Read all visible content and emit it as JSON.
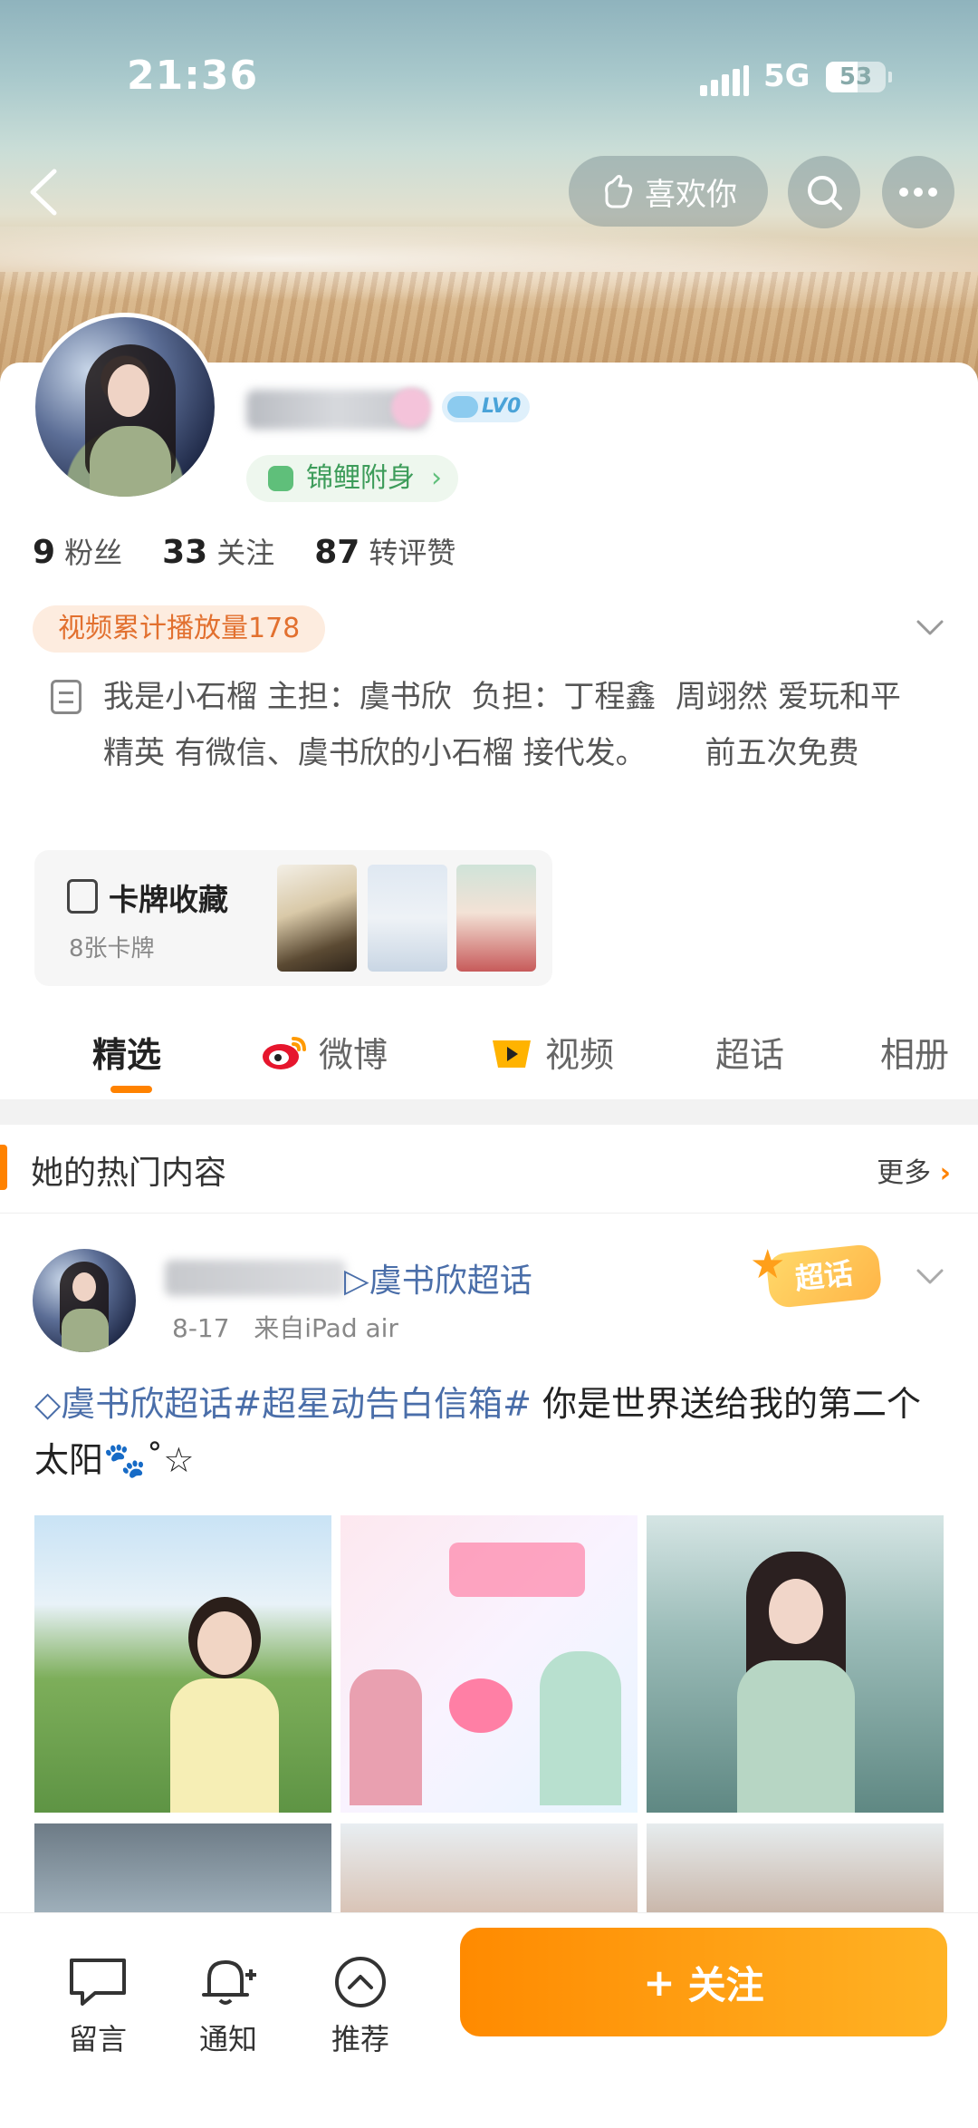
{
  "status_bar": {
    "time": "21:36",
    "network": "5G",
    "battery": "53"
  },
  "header": {
    "like_label": "喜欢你"
  },
  "profile": {
    "level_badge": "LV0",
    "koi_badge": "锦鲤附身",
    "stats": [
      {
        "value": "9",
        "label": "粉丝"
      },
      {
        "value": "33",
        "label": "关注"
      },
      {
        "value": "87",
        "label": "转评赞"
      }
    ],
    "video_plays": "视频累计播放量178",
    "bio": "我是小石榴 主担：虞书欣  负担：丁程鑫  周翊然 爱玩和平精英 有微信、虞书欣的小石榴 接代发。      前五次免费",
    "card_collection": {
      "title": "卡牌收藏",
      "subtitle": "8张卡牌"
    }
  },
  "tabs": [
    {
      "label": "精选",
      "active": true
    },
    {
      "label": "微博",
      "active": false
    },
    {
      "label": "视频",
      "active": false
    },
    {
      "label": "超话",
      "active": false
    },
    {
      "label": "相册",
      "active": false
    }
  ],
  "hot_section": {
    "title": "她的热门内容",
    "more_label": "更多"
  },
  "post": {
    "topic": "虞书欣超话",
    "date": "8-17",
    "source": "来自iPad air",
    "badge": "超话",
    "text_tag": "虞书欣超话#超星动告白信箱#",
    "text_body": " 你是世界送给我的第二个太阳🐾˚☆"
  },
  "bottom_bar": {
    "items": [
      {
        "label": "留言"
      },
      {
        "label": "通知"
      },
      {
        "label": "推荐"
      }
    ],
    "follow_label": "关注"
  },
  "colors": {
    "accent": "#ff8200",
    "link": "#4a6ea9",
    "badge_orange": "#e2702f",
    "koi_green": "#3d9c5a"
  }
}
